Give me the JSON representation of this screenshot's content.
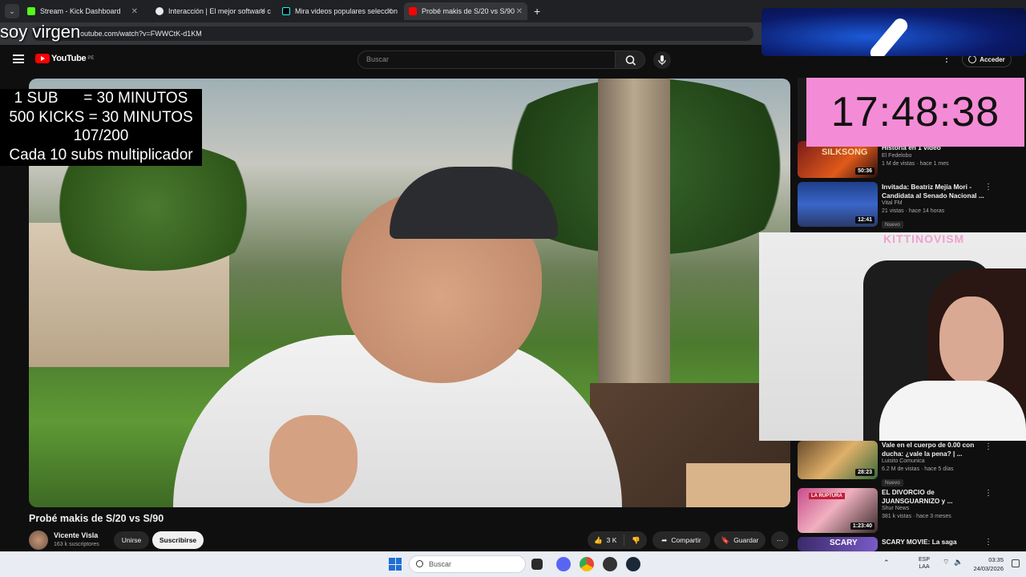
{
  "browser": {
    "tabs": [
      {
        "label": "Stream - Kick Dashboard",
        "active": false
      },
      {
        "label": "Interacción | El mejor software c",
        "active": false
      },
      {
        "label": "Mira videos populares selecciona",
        "active": false
      },
      {
        "label": "Probé makis de S/20 vs S/90",
        "active": true
      }
    ],
    "url": "outube.com/watch?v=FWWCtK-d1KM"
  },
  "youtube": {
    "logo_text": "YouTube",
    "logo_region": "PE",
    "search_placeholder": "Buscar",
    "signin_label": "Acceder",
    "video": {
      "title": "Probé makis de S/20 vs S/90",
      "channel": "Vicente Visla",
      "subscribers": "163 k suscriptores",
      "join_label": "Unirse",
      "subscribe_label": "Suscribirse",
      "likes": "3 K",
      "share_label": "Compartir",
      "save_label": "Guardar"
    },
    "recommendations": [
      {
        "title": "Historia en 1 video",
        "channel": "El Fedelobo",
        "meta": "1 M de vistas · hace 1 mes",
        "duration": "50:36",
        "thumb_text": "SILKSONG",
        "badge": ""
      },
      {
        "title": "Invitada: Beatriz Mejía Mori - Candidata al Senado Nacional ...",
        "channel": "Vital FM",
        "meta": "21 vistas · hace 14 horas",
        "duration": "12:41",
        "thumb_text": "",
        "badge": "Nuevo"
      },
      {
        "title": "Vale en el cuerpo de 0.00 con ducha: ¿vale la pena? | ...",
        "channel": "Luisito Comunica",
        "meta": "6.2 M de vistas · hace 5 días",
        "duration": "28:23",
        "thumb_text": "",
        "badge": "Nuevo"
      },
      {
        "title": "EL DIVORCIO de JUANSGUARNIZO y ...",
        "channel": "Shur News",
        "meta": "381 k vistas · hace 3 meses",
        "duration": "1:23:40",
        "thumb_text": "LA RUPTURA",
        "badge": ""
      },
      {
        "title": "SCARY MOVIE: La saga",
        "channel": "",
        "meta": "",
        "duration": "",
        "thumb_text": "SCARY",
        "badge": ""
      }
    ]
  },
  "overlay": {
    "headline": "soy virgen",
    "rules": [
      "1 SUB      = 30 MINUTOS",
      "500 KICKS = 30 MINUTOS",
      "107/200",
      "Cada 10 subs multiplicador"
    ],
    "timer": "17:48:38",
    "webcam_logo": "KITTINOVISM"
  },
  "taskbar": {
    "search_placeholder": "Buscar",
    "language": "ESP",
    "layout": "LAA",
    "time": "03:35",
    "date": "24/03/2026"
  },
  "colors": {
    "yt_red": "#ff0000",
    "timer_bg": "#f48bd6",
    "kick_green": "#53fc18"
  }
}
